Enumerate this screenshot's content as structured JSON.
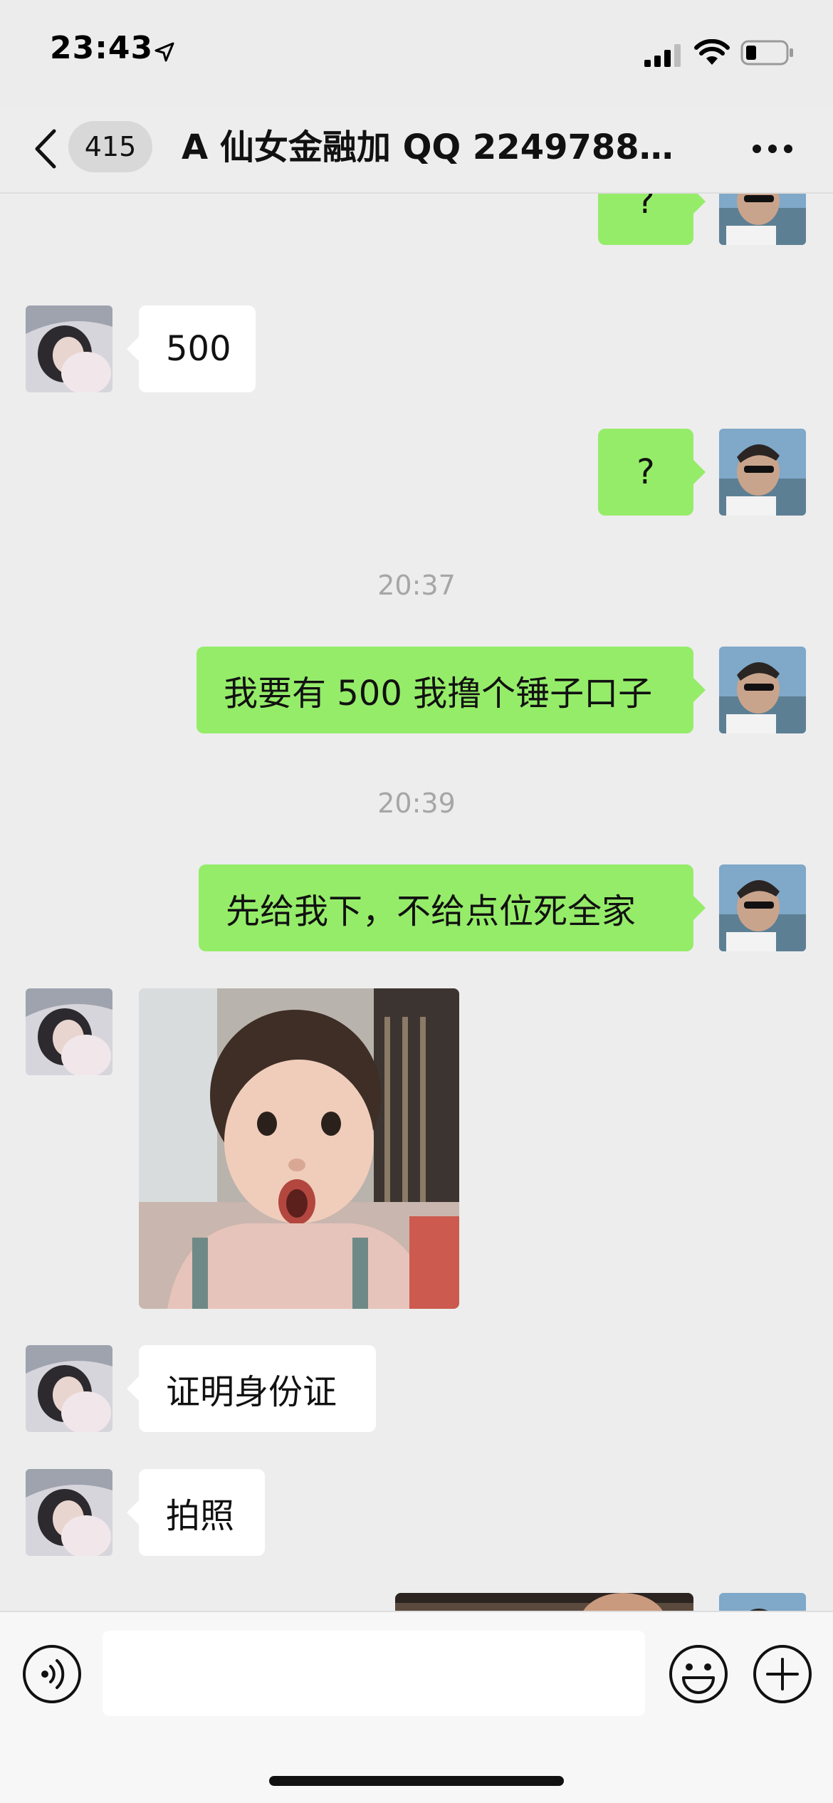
{
  "status_bar": {
    "time": "23:43"
  },
  "header": {
    "back_badge": "415",
    "title": "A 仙女金融加 QQ 22497884..."
  },
  "messages": [
    {
      "side": "out",
      "text": "?"
    },
    {
      "side": "in",
      "text": "500"
    },
    {
      "side": "out",
      "text": "?"
    },
    {
      "timestamp": "20:37"
    },
    {
      "side": "out",
      "text": "我要有 500 我撸个锤子口子"
    },
    {
      "timestamp": "20:39"
    },
    {
      "side": "out",
      "text": "先给我下，不给点位死全家"
    },
    {
      "side": "in",
      "type": "image",
      "description": "photo of a surprised child"
    },
    {
      "side": "in",
      "text": "证明身份证"
    },
    {
      "side": "in",
      "text": "拍照"
    },
    {
      "side": "out",
      "type": "image"
    }
  ],
  "input": {
    "value": "",
    "placeholder": ""
  },
  "colors": {
    "outgoing_bubble": "#95ec69",
    "incoming_bubble": "#ffffff",
    "background": "#ededed"
  }
}
